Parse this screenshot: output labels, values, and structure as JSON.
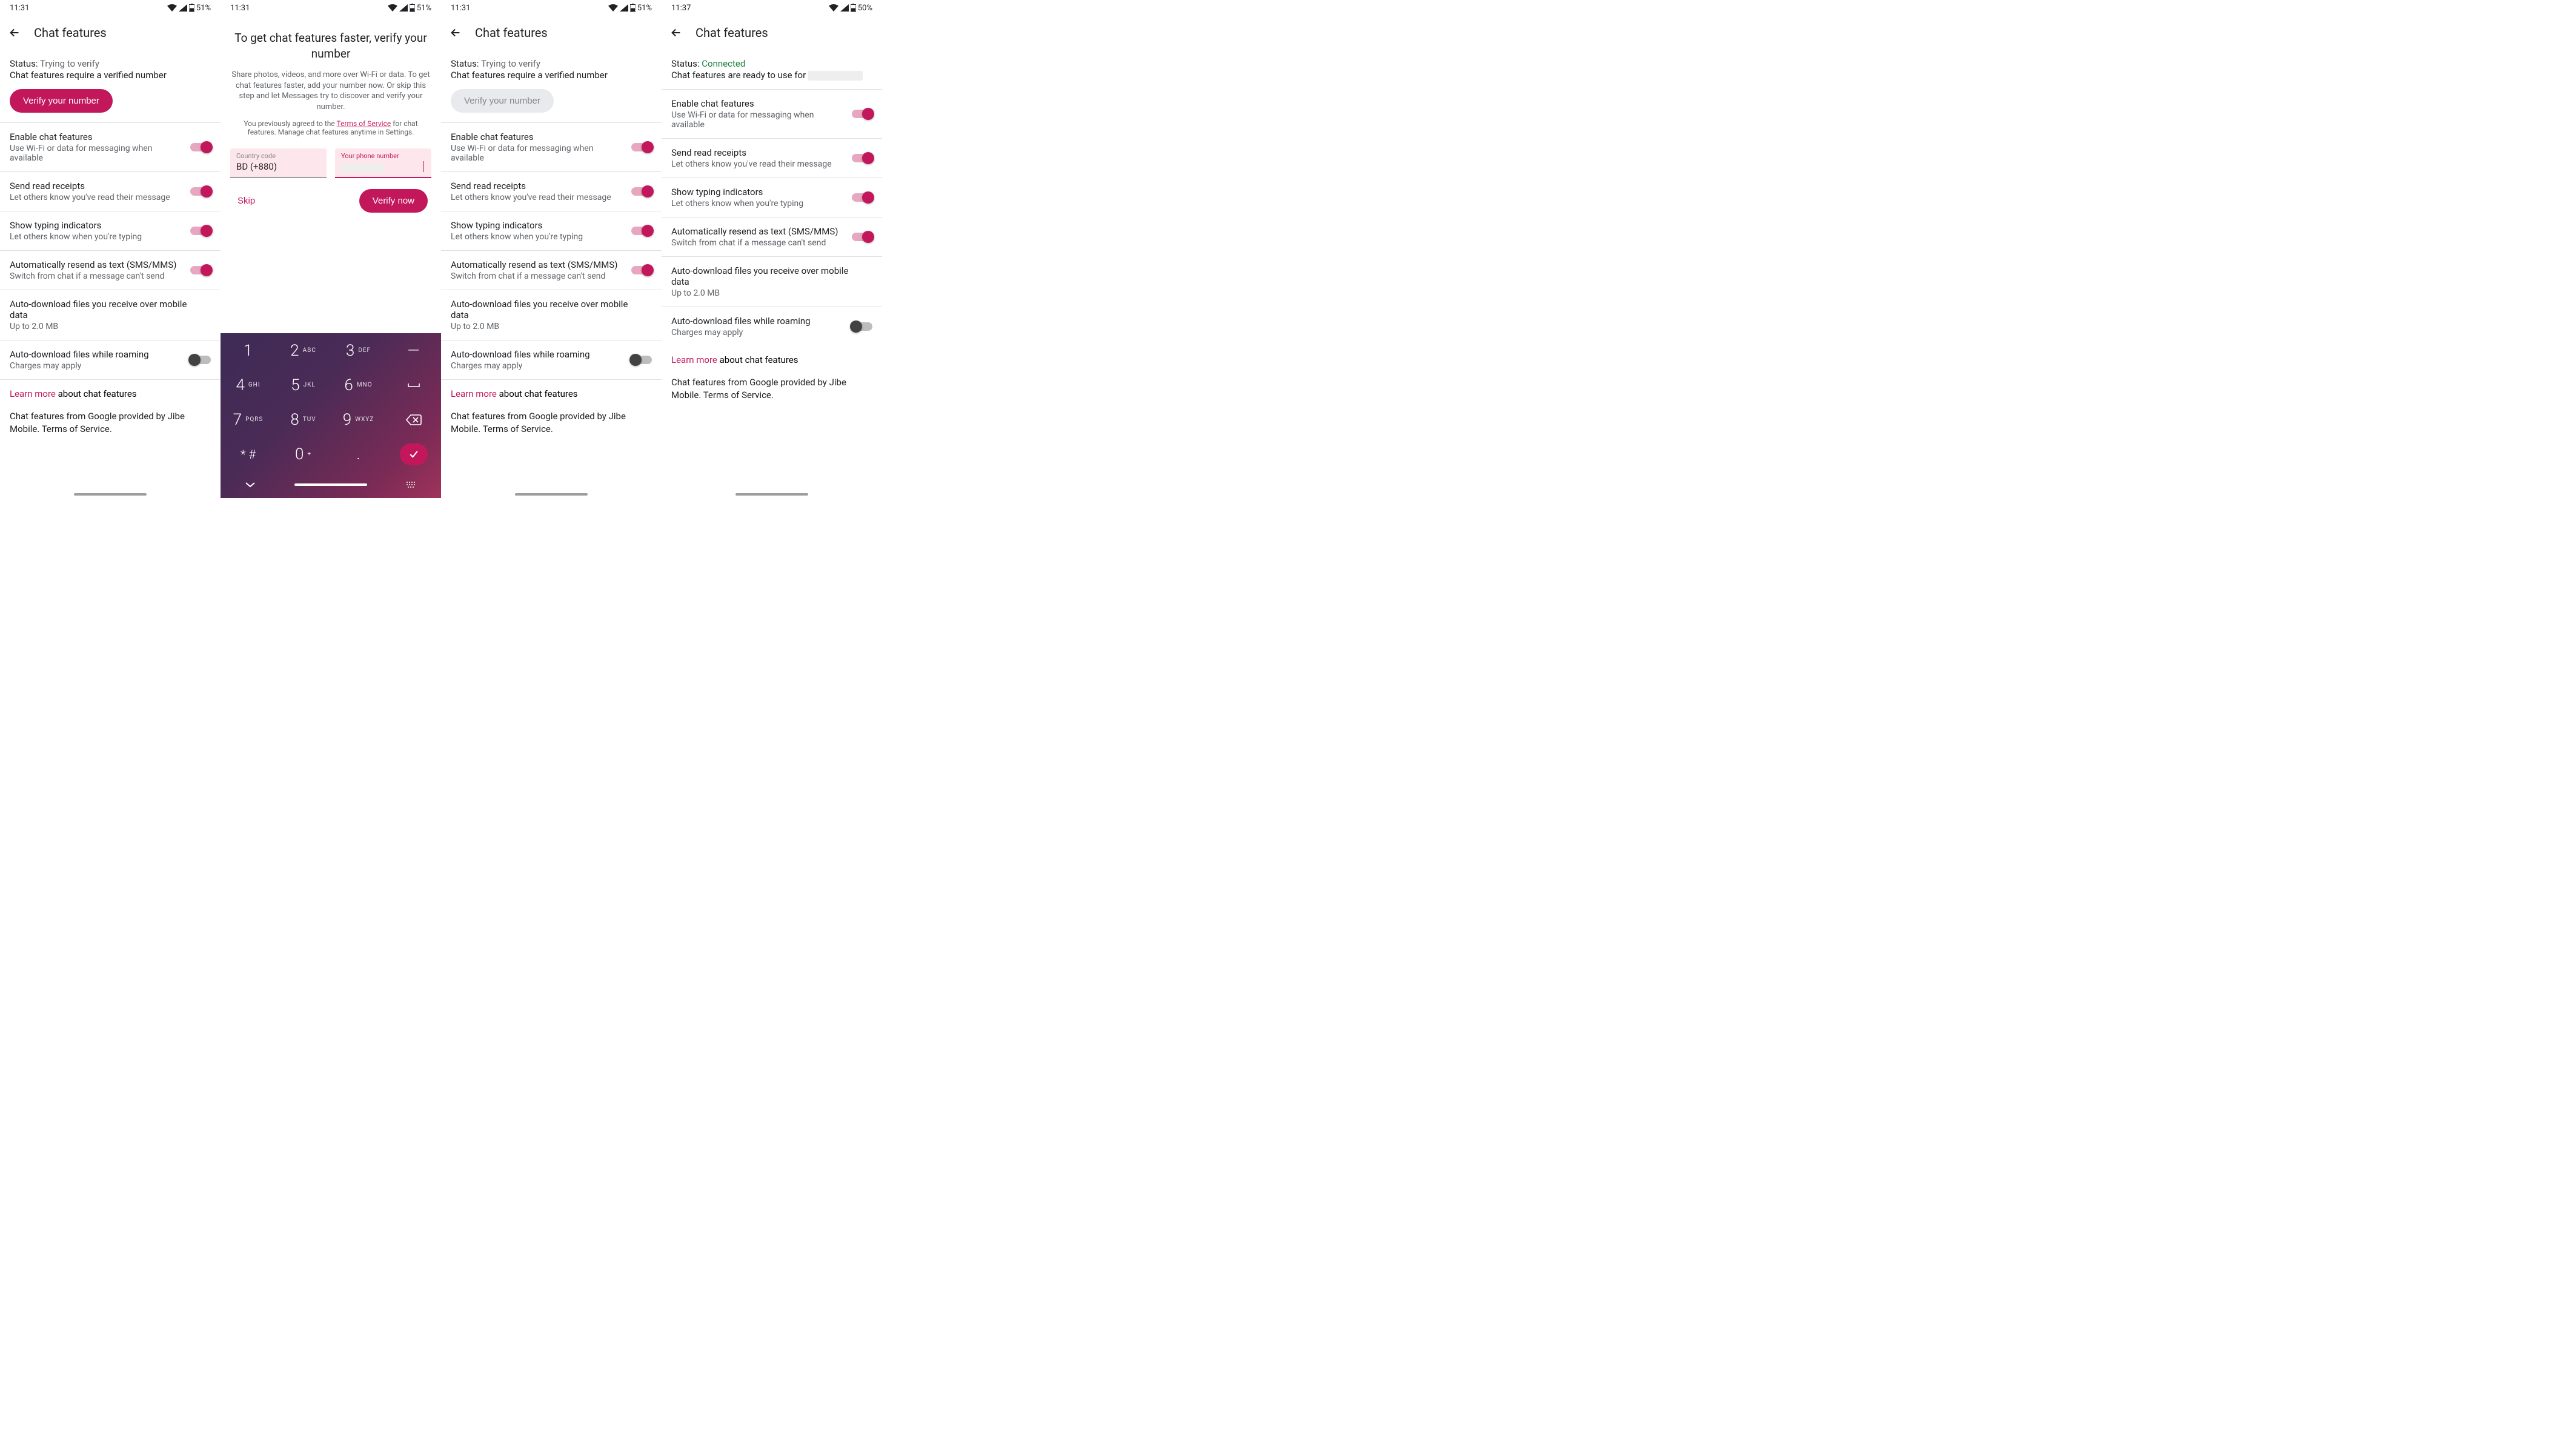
{
  "colors": {
    "accent": "#c2185b",
    "connected": "#188038",
    "textSecondary": "#5f6368"
  },
  "icons": {
    "wifi": "wifi-icon",
    "cell": "cell-signal-icon",
    "battery": "battery-icon",
    "back": "arrow-back-icon",
    "check": "check-icon",
    "backspace": "backspace-icon",
    "space": "space-icon",
    "chevronDown": "chevron-down-icon",
    "keyboard": "keyboard-icon"
  },
  "common": {
    "appbarTitle": "Chat features",
    "statusLabel": "Status:",
    "settings": {
      "enable": {
        "title": "Enable chat features",
        "sub": "Use Wi-Fi or data for messaging when available"
      },
      "receipts": {
        "title": "Send read receipts",
        "sub": "Let others know you've read their message"
      },
      "typing": {
        "title": "Show typing indicators",
        "sub": "Let others know when you're typing"
      },
      "resend": {
        "title": "Automatically resend as text (SMS/MMS)",
        "sub": "Switch from chat if a message can't send"
      },
      "autodl": {
        "title": "Auto-download files you receive over mobile data",
        "sub": "Up to 2.0 MB"
      },
      "roaming": {
        "title": "Auto-download files while roaming",
        "sub": "Charges may apply"
      }
    },
    "learnLabel": "Learn more",
    "learnRest": " about chat features",
    "footer": "Chat features from Google provided by Jibe Mobile. Terms of Service."
  },
  "screens": [
    {
      "time": "11:31",
      "battery": "51%",
      "statusValue": "Trying to verify",
      "statusSub": "Chat features require a verified number",
      "verifyBtn": {
        "label": "Verify your number",
        "enabled": true
      },
      "toggles": {
        "enable": true,
        "receipts": true,
        "typing": true,
        "resend": true,
        "autodl": true,
        "roaming": false
      }
    },
    {
      "time": "11:31",
      "battery": "51%",
      "dialog": {
        "title": "To get chat features faster, verify your number",
        "body": "Share photos, videos, and more over Wi-Fi or data. To get chat features faster, add your number now. Or skip this step and let Messages try to discover and verify your number.",
        "tosPre": "You previously agreed to the ",
        "tosLink": "Terms of Service",
        "tosPost": " for chat features. Manage chat features anytime in Settings.",
        "countryLabel": "Country code",
        "countryValue": "BD (+880)",
        "phoneLabel": "Your phone number",
        "phoneValue": "",
        "skip": "Skip",
        "verify": "Verify now"
      },
      "keypad": {
        "rows": [
          [
            {
              "d": "1",
              "l": ""
            },
            {
              "d": "2",
              "l": "ABC"
            },
            {
              "d": "3",
              "l": "DEF"
            },
            {
              "d": "—",
              "l": "",
              "sym": true
            }
          ],
          [
            {
              "d": "4",
              "l": "GHI"
            },
            {
              "d": "5",
              "l": "JKL"
            },
            {
              "d": "6",
              "l": "MNO"
            },
            {
              "d": "",
              "l": "",
              "space": true
            }
          ],
          [
            {
              "d": "7",
              "l": "PQRS"
            },
            {
              "d": "8",
              "l": "TUV"
            },
            {
              "d": "9",
              "l": "WXYZ"
            },
            {
              "d": "",
              "l": "",
              "back": true
            }
          ],
          [
            {
              "d": "* #",
              "l": ""
            },
            {
              "d": "0",
              "l": "+"
            },
            {
              "d": ".",
              "l": ""
            },
            {
              "d": "",
              "l": "",
              "ok": true
            }
          ]
        ]
      }
    },
    {
      "time": "11:31",
      "battery": "51%",
      "statusValue": "Trying to verify",
      "statusSub": "Chat features require a verified number",
      "verifyBtn": {
        "label": "Verify your number",
        "enabled": false
      },
      "toggles": {
        "enable": true,
        "receipts": true,
        "typing": true,
        "resend": true,
        "autodl": true,
        "roaming": false
      }
    },
    {
      "time": "11:37",
      "battery": "50%",
      "statusValue": "Connected",
      "statusConnected": true,
      "statusSubPrefix": "Chat features are ready to use for ",
      "verifyBtn": null,
      "toggles": {
        "enable": true,
        "receipts": true,
        "typing": true,
        "resend": true,
        "autodl": true,
        "roaming": false
      }
    }
  ]
}
